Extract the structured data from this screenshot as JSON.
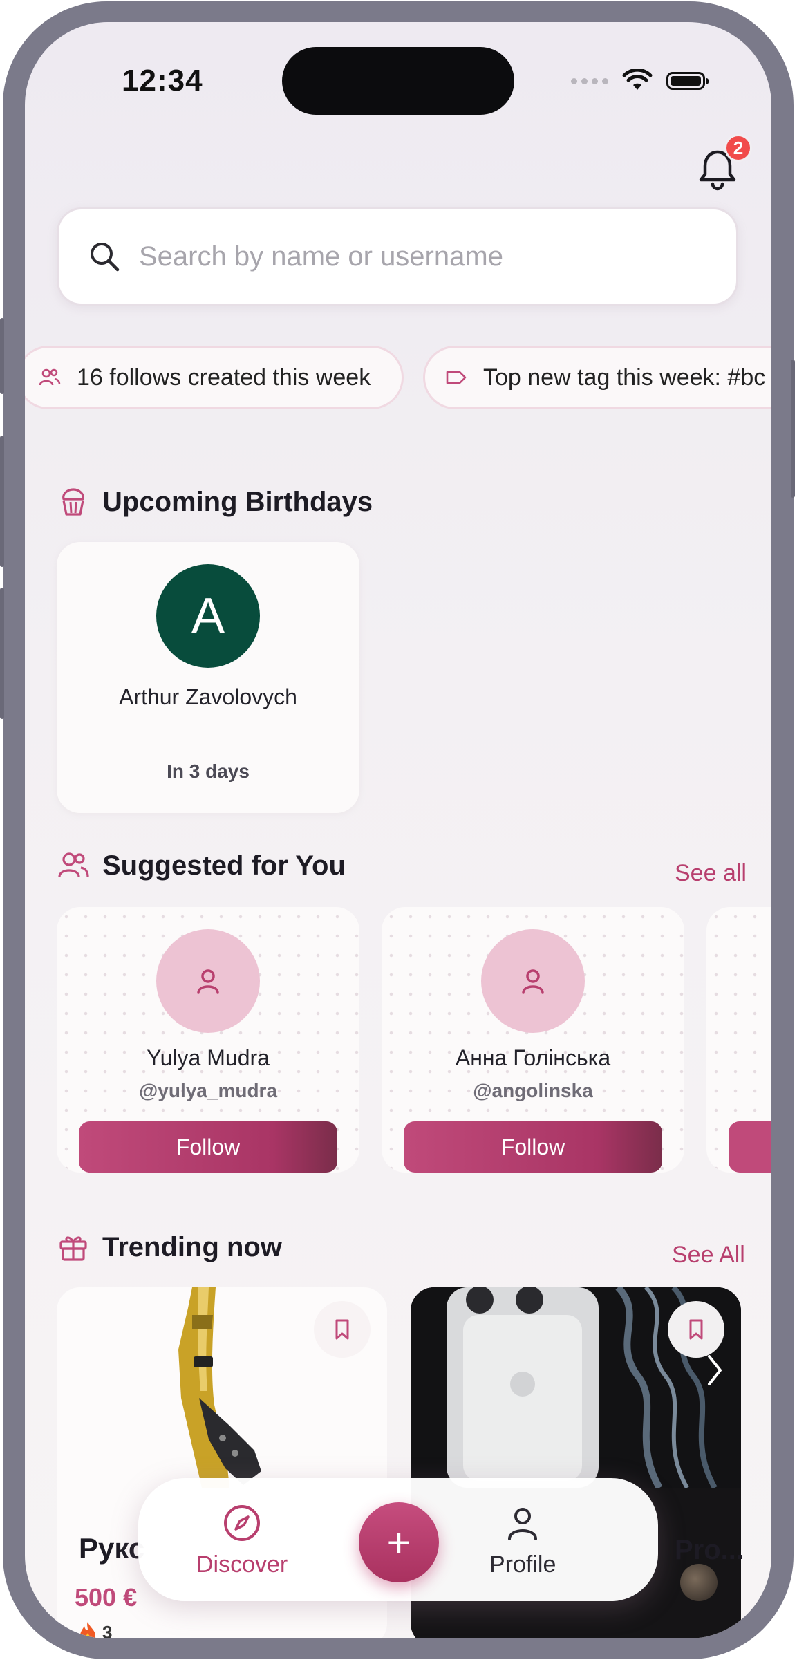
{
  "status_bar": {
    "time": "12:34"
  },
  "notifications": {
    "count": "2"
  },
  "search": {
    "placeholder": "Search by name or username"
  },
  "chips": [
    {
      "icon": "users-icon",
      "label": "16 follows created this week"
    },
    {
      "icon": "tag-icon",
      "label": "Top new tag this week: #bc"
    }
  ],
  "birthdays": {
    "title": "Upcoming Birthdays",
    "items": [
      {
        "initial": "A",
        "name": "Arthur Zavolovych",
        "when": "In 3 days",
        "avatar_color": "#084c3c"
      }
    ]
  },
  "suggested": {
    "title": "Suggested for You",
    "see_all": "See all",
    "items": [
      {
        "name": "Yulya Mudra",
        "handle": "@yulya_mudra",
        "button": "Follow"
      },
      {
        "name": "Анна Голінська",
        "handle": "@angolinska",
        "button": "Follow"
      }
    ]
  },
  "trending": {
    "title": "Trending now",
    "see_all": "See All",
    "items": [
      {
        "title": "Рукс",
        "price": "500 €",
        "likes": "3"
      },
      {
        "title": "Pro..."
      }
    ]
  },
  "bottom_nav": {
    "discover": "Discover",
    "profile": "Profile",
    "add": "+"
  },
  "colors": {
    "accent": "#b83f6e",
    "avatar_pink": "#edc3d3",
    "badge_red": "#f14b4b"
  }
}
